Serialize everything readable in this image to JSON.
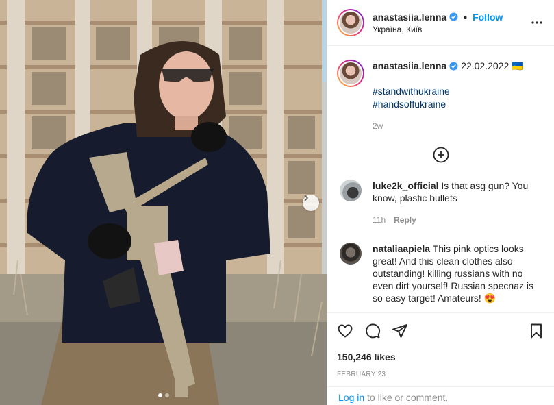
{
  "post": {
    "author": {
      "username": "anastasiia.lenna",
      "verified": true,
      "location": "Україна, Київ",
      "follow_label": "Follow",
      "separator": "•"
    },
    "caption": {
      "date_text": "22.02.2022 🇺🇦",
      "hashtags": [
        "#standwithukraine",
        "#handsoffukraine"
      ],
      "time_ago": "2w"
    },
    "comments": [
      {
        "username": "luke2k_official",
        "text": "Is that asg gun? You know, plastic bullets",
        "time_ago": "11h",
        "reply_label": "Reply"
      },
      {
        "username": "nataliaapiela",
        "text": "This pink optics looks great! And this clean clothes also outstanding! killing russians with no even dirt yourself! Russian specnaz is so easy target! Amateurs! 😍",
        "time_ago": "",
        "reply_label": ""
      }
    ],
    "likes_text": "150,246 likes",
    "post_date": "FEBRUARY 23",
    "carousel": {
      "count": 2,
      "active_index": 0
    }
  },
  "login_bar": {
    "link": "Log in",
    "rest": " to like or comment."
  },
  "icons": {
    "verified": "verified-badge-icon",
    "more": "more-options-icon",
    "load_more": "load-more-comments-icon",
    "like": "heart-icon",
    "comment": "comment-bubble-icon",
    "share": "paper-plane-icon",
    "save": "bookmark-icon",
    "next": "chevron-right-icon"
  },
  "colors": {
    "accent": "#0095f6",
    "hashtag": "#00376b",
    "muted": "#8e8e8e",
    "text": "#262626",
    "border": "#efefef"
  }
}
